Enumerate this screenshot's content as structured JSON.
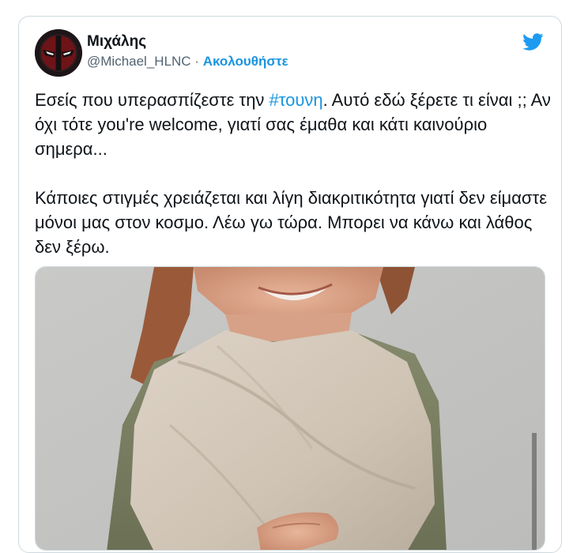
{
  "tweet": {
    "author": {
      "display_name": "Μιχάλης",
      "handle": "@Michael_HLNC",
      "separator": " · ",
      "follow_label": "Ακολουθήστε",
      "avatar_icon": "deadpool-mask-avatar"
    },
    "logo_icon": "twitter-bird-icon",
    "paragraph1": {
      "before_hashtag": "Εσείς που υπερασπίζεστε την ",
      "hashtag": "#τουνη",
      "after_hashtag": ". Αυτό εδώ ξέρετε τι είναι ;; Αν όχι τότε you're welcome, γιατί σας έμαθα και κάτι καινούριο σημερα..."
    },
    "paragraph2": "Κάποιες στιγμές χρειάζεται και λίγη διακριτικότητα γιατί δεν είμαστε μόνοι μας στον κοσμο. Λέω γω τώρα. Μπορει να κάνω και λάθος δεν ξέρω.",
    "colors": {
      "link": "#1b95e0",
      "text": "#0f1419",
      "secondary": "#536471"
    }
  }
}
